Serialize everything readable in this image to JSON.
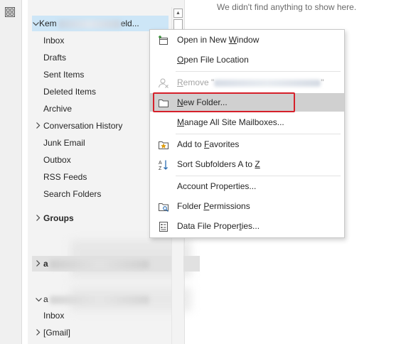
{
  "rail": {
    "apps_icon": "apps-grid-icon"
  },
  "notice": {
    "empty_message": "We didn't find anything to show here."
  },
  "folders": {
    "account1": {
      "name_visible": "Kem",
      "name_suffix": "eld...",
      "items": [
        "Inbox",
        "Drafts",
        "Sent Items",
        "Deleted Items",
        "Archive",
        "Conversation History",
        "Junk Email",
        "Outbox",
        "RSS Feeds",
        "Search Folders"
      ]
    },
    "groups_label": "Groups",
    "account2": {
      "name_visible": "a"
    },
    "account3": {
      "name_visible": "a",
      "items": [
        "Inbox",
        "[Gmail]"
      ]
    }
  },
  "context_menu": {
    "open_new_window": {
      "pre": "Open in New ",
      "u": "W",
      "post": "indow",
      "icon": "new-window-icon"
    },
    "open_file_location": {
      "pre": "",
      "u": "O",
      "post": "pen File Location"
    },
    "remove": {
      "pre": "",
      "u": "R",
      "post": "emove \"",
      "tail": "\"",
      "icon": "remove-person-icon",
      "disabled": true
    },
    "new_folder": {
      "pre": "",
      "u": "N",
      "post": "ew Folder...",
      "icon": "folder-icon"
    },
    "manage_mailboxes": {
      "pre": "",
      "u": "M",
      "post": "anage All Site Mailboxes..."
    },
    "add_favorites": {
      "pre": "Add to ",
      "u": "F",
      "post": "avorites",
      "icon": "favorite-star-icon"
    },
    "sort_subfolders": {
      "pre": "Sort Subfolders A to ",
      "u": "Z",
      "post": "",
      "icon": "sort-az-icon"
    },
    "account_properties": {
      "pre": "Account Properties...",
      "u": "",
      "post": ""
    },
    "folder_permissions": {
      "pre": "Folder ",
      "u": "P",
      "post": "ermissions",
      "icon": "folder-permissions-icon"
    },
    "data_file_properties": {
      "pre": "Data File Proper",
      "u": "t",
      "post": "ies...",
      "icon": "properties-icon"
    }
  },
  "colors": {
    "selection_blue": "#cde6f7",
    "menu_hover": "#d0d0d0",
    "highlight_red": "#d6202a",
    "disabled_text": "#a6a6a6"
  }
}
